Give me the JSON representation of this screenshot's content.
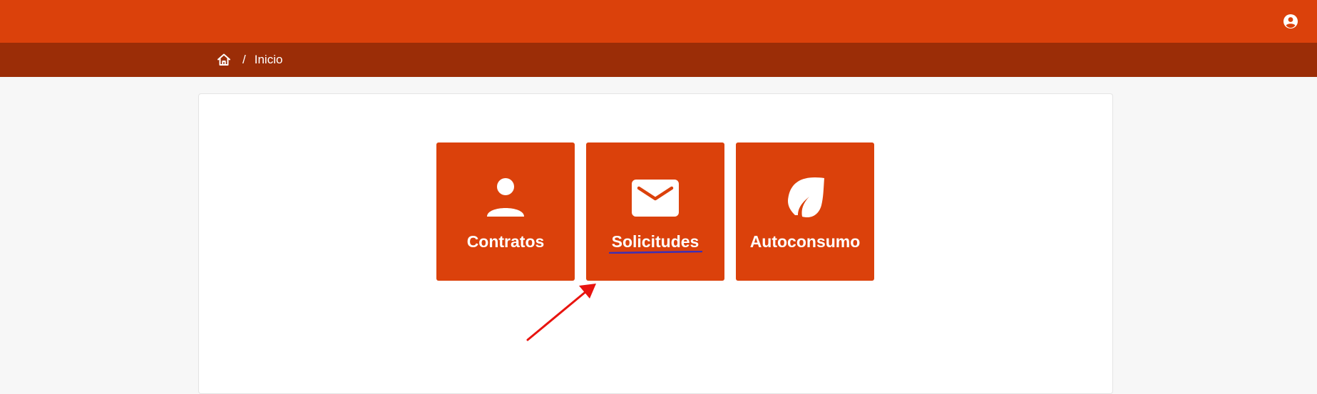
{
  "colors": {
    "topbar": "#db410b",
    "breadcrumb_bar": "#9b2d07",
    "tile": "#db410b",
    "annotation_arrow": "#e8140f",
    "annotation_underline": "#3d2fb5"
  },
  "header": {
    "user_icon": "user-circle-icon"
  },
  "breadcrumb": {
    "home_icon": "home-icon",
    "separator": "/",
    "current": "Inicio"
  },
  "tiles": [
    {
      "label": "Contratos",
      "icon": "person-icon"
    },
    {
      "label": "Solicitudes",
      "icon": "envelope-icon"
    },
    {
      "label": "Autoconsumo",
      "icon": "leaf-icon"
    }
  ]
}
